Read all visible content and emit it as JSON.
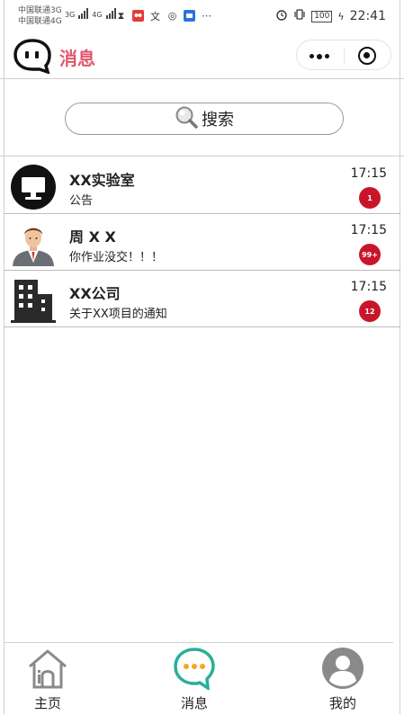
{
  "status_bar": {
    "carrier_1": "中国联通3G",
    "carrier_2": "中国联通4G",
    "net_1": "3G",
    "net_2": "4G",
    "battery": "100",
    "time": "22:41"
  },
  "header": {
    "title": "消息",
    "title_color": "#e0566d"
  },
  "search": {
    "placeholder": "搜索"
  },
  "messages": [
    {
      "name": "XX实验室",
      "preview": "公告",
      "time": "17:15",
      "badge": "1",
      "avatar": "monitor-icon"
    },
    {
      "name": "周 X X",
      "preview": "你作业没交！！！",
      "time": "17:15",
      "badge": "99+",
      "avatar": "businessman-avatar"
    },
    {
      "name": "XX公司",
      "preview": "关于XX项目的通知",
      "time": "17:15",
      "badge": "12",
      "avatar": "building-icon"
    }
  ],
  "tabbar": {
    "items": [
      {
        "label": "主页",
        "icon": "home-icon"
      },
      {
        "label": "消息",
        "icon": "chat-bubble-icon",
        "active": true
      },
      {
        "label": "我的",
        "icon": "user-icon"
      }
    ],
    "active_color": "#2bae9a",
    "dot_color": "#f5a623"
  },
  "colors": {
    "badge": "#c9152a",
    "divider": "#bdbdbd"
  }
}
